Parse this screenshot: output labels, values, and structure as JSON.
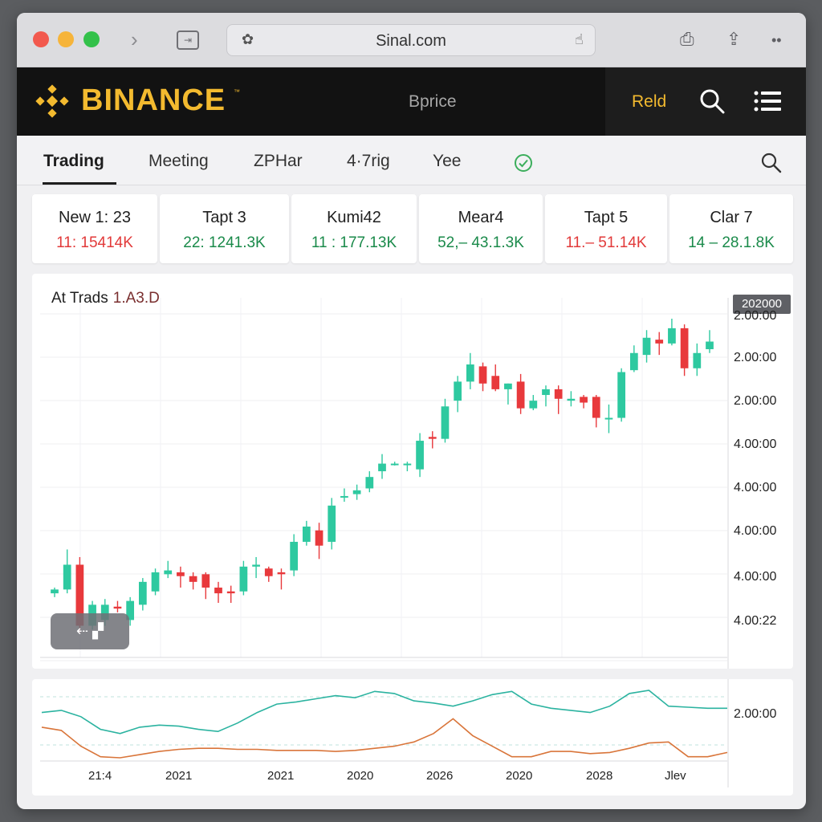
{
  "browser": {
    "url": "Sinal.com",
    "icons": [
      "close-dot",
      "minimize-dot",
      "zoom-dot",
      "chevron-right-icon",
      "sidebar-icon",
      "extension-icon",
      "hand-icon",
      "share-icon",
      "tabs-icon",
      "more-icon"
    ]
  },
  "header": {
    "logo_text": "BINANCE",
    "logo_tm": "™",
    "center_label": "Bprice",
    "link_label": "Reld",
    "brand_color": "#f3ba2f"
  },
  "tabs": [
    {
      "label": "Trading",
      "active": true
    },
    {
      "label": "Meeting",
      "active": false
    },
    {
      "label": "ZPHar",
      "active": false
    },
    {
      "label": "4·7rig",
      "active": false
    },
    {
      "label": "Yee",
      "active": false
    }
  ],
  "tickers": [
    {
      "name": "New 1: 23",
      "value": "11: 15414K",
      "status": "neg"
    },
    {
      "name": "Tapt 3",
      "value": "22: 1241.3K",
      "status": "pos"
    },
    {
      "name": "Kumi42",
      "value": "11 : 177.13K",
      "status": "pos"
    },
    {
      "name": "Mear4",
      "value": "52,– 43.1.3K",
      "status": "pos"
    },
    {
      "name": "Tapt 5",
      "value": "11.– 51.14K",
      "status": "neg"
    },
    {
      "name": "Clar 7",
      "value": "14 – 28.1.8K",
      "status": "pos"
    }
  ],
  "chart": {
    "title": "At Trads",
    "title_sub": "1.A3.D",
    "price_tag": "202000",
    "tool_label": "⇠ ▞",
    "y_labels": [
      "2.00:00",
      "2.00:00",
      "2.00:00",
      "4.00:00",
      "4.00:00",
      "4.00:00",
      "4.00:00",
      "4.00:22"
    ],
    "up_color": "#2ec9a0",
    "down_color": "#e8393c"
  },
  "indicator": {
    "y_label": "2.00:00",
    "x_labels": [
      "21:4",
      "2021",
      "2021",
      "2020",
      "2026",
      "2020",
      "2028",
      "Jlev"
    ],
    "line_colors": [
      "#2bb3a0",
      "#d9753a"
    ]
  },
  "chart_data": {
    "type": "candlestick",
    "title": "At Trads",
    "candles": [
      {
        "o": 17,
        "c": 19,
        "h": 20,
        "l": 15
      },
      {
        "o": 19,
        "c": 32,
        "h": 40,
        "l": 17
      },
      {
        "o": 32,
        "c": 0,
        "h": 36,
        "l": -4
      },
      {
        "o": 0,
        "c": 11,
        "h": 13,
        "l": -2
      },
      {
        "o": 3,
        "c": 11,
        "h": 14,
        "l": 0
      },
      {
        "o": 10,
        "c": 9,
        "h": 13,
        "l": 7
      },
      {
        "o": 3,
        "c": 13,
        "h": 15,
        "l": 0
      },
      {
        "o": 11,
        "c": 23,
        "h": 25,
        "l": 8
      },
      {
        "o": 18,
        "c": 28,
        "h": 30,
        "l": 16
      },
      {
        "o": 27,
        "c": 29,
        "h": 34,
        "l": 25
      },
      {
        "o": 28,
        "c": 26,
        "h": 31,
        "l": 20
      },
      {
        "o": 26,
        "c": 23,
        "h": 28,
        "l": 19
      },
      {
        "o": 27,
        "c": 20,
        "h": 28,
        "l": 14
      },
      {
        "o": 20,
        "c": 17,
        "h": 23,
        "l": 12
      },
      {
        "o": 18,
        "c": 17,
        "h": 21,
        "l": 12
      },
      {
        "o": 18,
        "c": 31,
        "h": 34,
        "l": 16
      },
      {
        "o": 31,
        "c": 32,
        "h": 36,
        "l": 25
      },
      {
        "o": 30,
        "c": 26,
        "h": 31,
        "l": 23
      },
      {
        "o": 28,
        "c": 27,
        "h": 30,
        "l": 19
      },
      {
        "o": 29,
        "c": 44,
        "h": 48,
        "l": 26
      },
      {
        "o": 44,
        "c": 52,
        "h": 55,
        "l": 42
      },
      {
        "o": 50,
        "c": 42,
        "h": 54,
        "l": 35
      },
      {
        "o": 44,
        "c": 63,
        "h": 67,
        "l": 40
      },
      {
        "o": 68,
        "c": 68,
        "h": 72,
        "l": 65
      },
      {
        "o": 69,
        "c": 71,
        "h": 74,
        "l": 66
      },
      {
        "o": 72,
        "c": 78,
        "h": 81,
        "l": 70
      },
      {
        "o": 81,
        "c": 85,
        "h": 90,
        "l": 77
      },
      {
        "o": 85,
        "c": 85,
        "h": 86,
        "l": 84
      },
      {
        "o": 85,
        "c": 85,
        "h": 86,
        "l": 81
      },
      {
        "o": 82,
        "c": 97,
        "h": 101,
        "l": 78
      },
      {
        "o": 99,
        "c": 98,
        "h": 102,
        "l": 93
      },
      {
        "o": 98,
        "c": 115,
        "h": 119,
        "l": 96
      },
      {
        "o": 118,
        "c": 128,
        "h": 131,
        "l": 112
      },
      {
        "o": 128,
        "c": 137,
        "h": 143,
        "l": 124
      },
      {
        "o": 136,
        "c": 127,
        "h": 138,
        "l": 123
      },
      {
        "o": 131,
        "c": 124,
        "h": 137,
        "l": 123
      },
      {
        "o": 124,
        "c": 127,
        "h": 127,
        "l": 116
      },
      {
        "o": 128,
        "c": 114,
        "h": 132,
        "l": 111
      },
      {
        "o": 114,
        "c": 118,
        "h": 121,
        "l": 113
      },
      {
        "o": 121,
        "c": 124,
        "h": 126,
        "l": 115
      },
      {
        "o": 124,
        "c": 119,
        "h": 126,
        "l": 111
      },
      {
        "o": 118,
        "c": 119,
        "h": 123,
        "l": 115
      },
      {
        "o": 120,
        "c": 117,
        "h": 121,
        "l": 114
      },
      {
        "o": 120,
        "c": 109,
        "h": 121,
        "l": 104
      },
      {
        "o": 109,
        "c": 109,
        "h": 116,
        "l": 101
      },
      {
        "o": 109,
        "c": 133,
        "h": 135,
        "l": 107
      },
      {
        "o": 134,
        "c": 143,
        "h": 147,
        "l": 133
      },
      {
        "o": 142,
        "c": 151,
        "h": 155,
        "l": 138
      },
      {
        "o": 150,
        "c": 148,
        "h": 154,
        "l": 142
      },
      {
        "o": 148,
        "c": 156,
        "h": 161,
        "l": 147
      },
      {
        "o": 156,
        "c": 135,
        "h": 158,
        "l": 131
      },
      {
        "o": 135,
        "c": 143,
        "h": 148,
        "l": 131
      },
      {
        "o": 145,
        "c": 149,
        "h": 155,
        "l": 143
      }
    ],
    "indicator_series": [
      {
        "values": [
          62,
          64,
          58,
          46,
          42,
          48,
          50,
          49,
          46,
          44,
          52,
          62,
          70,
          72,
          75,
          78,
          76,
          82,
          80,
          73,
          71,
          68,
          73,
          79,
          82,
          70,
          66,
          64,
          62,
          68,
          80,
          83,
          68,
          67,
          66,
          66
        ]
      },
      {
        "values": [
          48,
          45,
          30,
          20,
          19,
          22,
          25,
          27,
          28,
          28,
          27,
          27,
          26,
          26,
          26,
          25,
          26,
          28,
          30,
          34,
          42,
          56,
          40,
          30,
          20,
          20,
          25,
          25,
          23,
          24,
          28,
          33,
          34,
          20,
          20,
          24
        ]
      }
    ]
  }
}
